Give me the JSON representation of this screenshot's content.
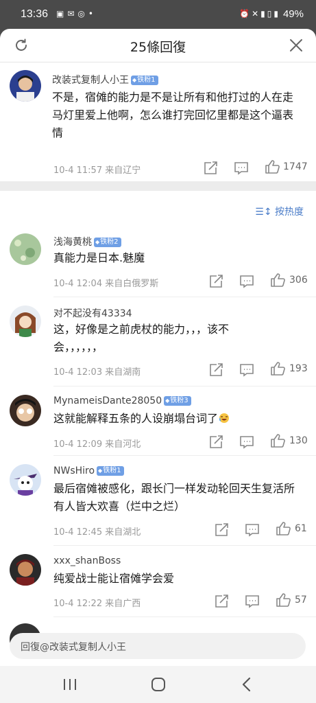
{
  "status": {
    "time": "13:36",
    "battery": "49%"
  },
  "header": {
    "title": "25條回復"
  },
  "main_comment": {
    "username": "改装式复制人小王",
    "badge": "铁粉1",
    "text": "不是，宿傩的能力是不是让所有和他打过的人在走马灯里爱上他啊，怎么谁打完回忆里都是这个逼表情",
    "time": "10-4 11:57",
    "location": "来自辽宁",
    "likes": "1747"
  },
  "sort_label": "按热度",
  "replies": [
    {
      "username": "浅海黄桃",
      "badge": "铁粉2",
      "text": "真能力是日本.魅魔",
      "time": "10-4 12:04",
      "location": "来自白俄罗斯",
      "likes": "306"
    },
    {
      "username": "对不起没有43334",
      "badge": "",
      "text": "这，好像是之前虎杖的能力，，，该不会，，，，，，",
      "time": "10-4 12:03",
      "location": "来自湖南",
      "likes": "193"
    },
    {
      "username": "MynameisDante28050",
      "badge": "铁粉3",
      "text": "这就能解释五条的人设崩塌台词了",
      "time": "10-4 12:09",
      "location": "来自河北",
      "likes": "130"
    },
    {
      "username": "NWsHiro",
      "badge": "铁粉1",
      "text": "最后宿傩被感化，跟长门一样发动轮回天生复活所有人皆大欢喜（烂中之烂）",
      "time": "10-4 12:45",
      "location": "来自湖北",
      "likes": "61"
    },
    {
      "username": "xxx_shanBoss",
      "badge": "",
      "text": "纯爱战士能让宿傩学会爱",
      "time": "10-4 12:22",
      "location": "来自广西",
      "likes": "57"
    }
  ],
  "reply_input": {
    "placeholder": "回復@改装式复制人小王"
  },
  "colors": {
    "accent": "#4a7cc8",
    "badge": "#6f9fe5"
  }
}
